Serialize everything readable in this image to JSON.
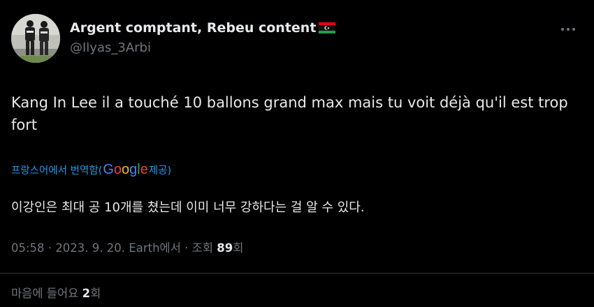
{
  "tweet": {
    "author": {
      "display_name": "Argent comptant, Rebeu content",
      "handle": "@Ilyas_3Arbi",
      "flag_icon": "libya-flag-icon"
    },
    "text": "Kang In Lee il a touché 10 ballons grand max mais tu voit déjà qu'il est trop fort",
    "translation": {
      "label_prefix": "프랑스어에서 번역함(",
      "provider": "Google",
      "label_suffix": " 제공)",
      "translated_text": "이강인은 최대 공 10개를 쳤는데 이미 너무 강하다는 걸 알 수 있다."
    },
    "meta": {
      "time": "05:58",
      "separator": " · ",
      "date": "2023. 9. 20.",
      "source": "Earth에서",
      "views_label": "조회",
      "views_count": "89",
      "views_unit": "회"
    },
    "likes": {
      "label": "마음에 들어요",
      "count": "2",
      "unit": "회"
    }
  },
  "colors": {
    "background": "#000000",
    "text_primary": "#e7e9ea",
    "text_secondary": "#71767b",
    "link_blue": "#1d9bf0",
    "divider": "#2f3336"
  },
  "icons": {
    "more": "more-horizontal-icon"
  }
}
